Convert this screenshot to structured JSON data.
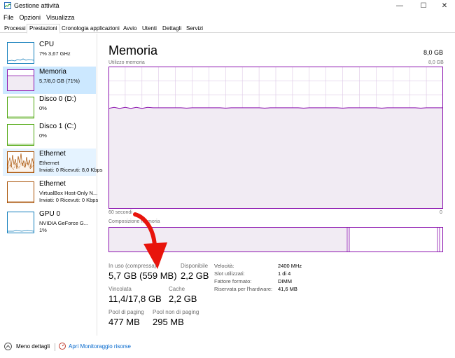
{
  "window": {
    "title": "Gestione attività"
  },
  "menu": [
    "File",
    "Opzioni",
    "Visualizza"
  ],
  "tabs": [
    "Processi",
    "Prestazioni",
    "Cronologia applicazioni",
    "Avvio",
    "Utenti",
    "Dettagli",
    "Servizi"
  ],
  "active_tab": "Prestazioni",
  "sidebar": {
    "items": [
      {
        "title": "CPU",
        "line1": "7% 3,67 GHz",
        "line2": "",
        "color": "#117dbb"
      },
      {
        "title": "Memoria",
        "line1": "5,7/8,0 GB (71%)",
        "line2": "",
        "color": "#8b12ae"
      },
      {
        "title": "Disco 0 (D:)",
        "line1": "0%",
        "line2": "",
        "color": "#4da60c"
      },
      {
        "title": "Disco 1 (C:)",
        "line1": "0%",
        "line2": "",
        "color": "#4da60c"
      },
      {
        "title": "Ethernet",
        "line1": "Ethernet",
        "line2": "Inviati: 0 Ricevuti: 8,0 Kbps",
        "color": "#a74f01"
      },
      {
        "title": "Ethernet",
        "line1": "VirtualBox Host-Only N...",
        "line2": "Inviati: 0 Ricevuti: 0 Kbps",
        "color": "#a74f01"
      },
      {
        "title": "GPU 0",
        "line1": "NVIDIA GeForce G...",
        "line2": "1%",
        "color": "#117dbb"
      }
    ]
  },
  "main": {
    "title": "Memoria",
    "total": "8,0 GB",
    "graph_label": "Utilizzo memoria",
    "graph_max": "8,0 GB",
    "graph_time": "60 secondi",
    "graph_min": "0",
    "composition_label": "Composizione memoria",
    "usage_fraction": 0.71
  },
  "stats": {
    "in_use_label": "In uso (compressa)",
    "in_use_value": "5,7 GB (559 MB)",
    "available_label": "Disponibile",
    "available_value": "2,2 GB",
    "committed_label": "Vincolata",
    "committed_value": "11,4/17,8 GB",
    "cache_label": "Cache",
    "cache_value": "2,2 GB",
    "paged_label": "Pool di paging",
    "paged_value": "477 MB",
    "nonpaged_label": "Pool non di paging",
    "nonpaged_value": "295 MB"
  },
  "details": [
    {
      "label": "Velocità:",
      "value": "2400 MHz"
    },
    {
      "label": "Slot utilizzati:",
      "value": "1 di 4"
    },
    {
      "label": "Fattore formato:",
      "value": "DIMM"
    },
    {
      "label": "Riservata per l'hardware:",
      "value": "41,6 MB"
    }
  ],
  "footer": {
    "less_details": "Meno dettagli",
    "resource_monitor": "Apri Monitoraggio risorse"
  },
  "colors": {
    "memory_line": "#8b12ae",
    "memory_fill": "#f1ebf3",
    "grid": "#dcc7e5",
    "arrow": "#e8140c"
  }
}
